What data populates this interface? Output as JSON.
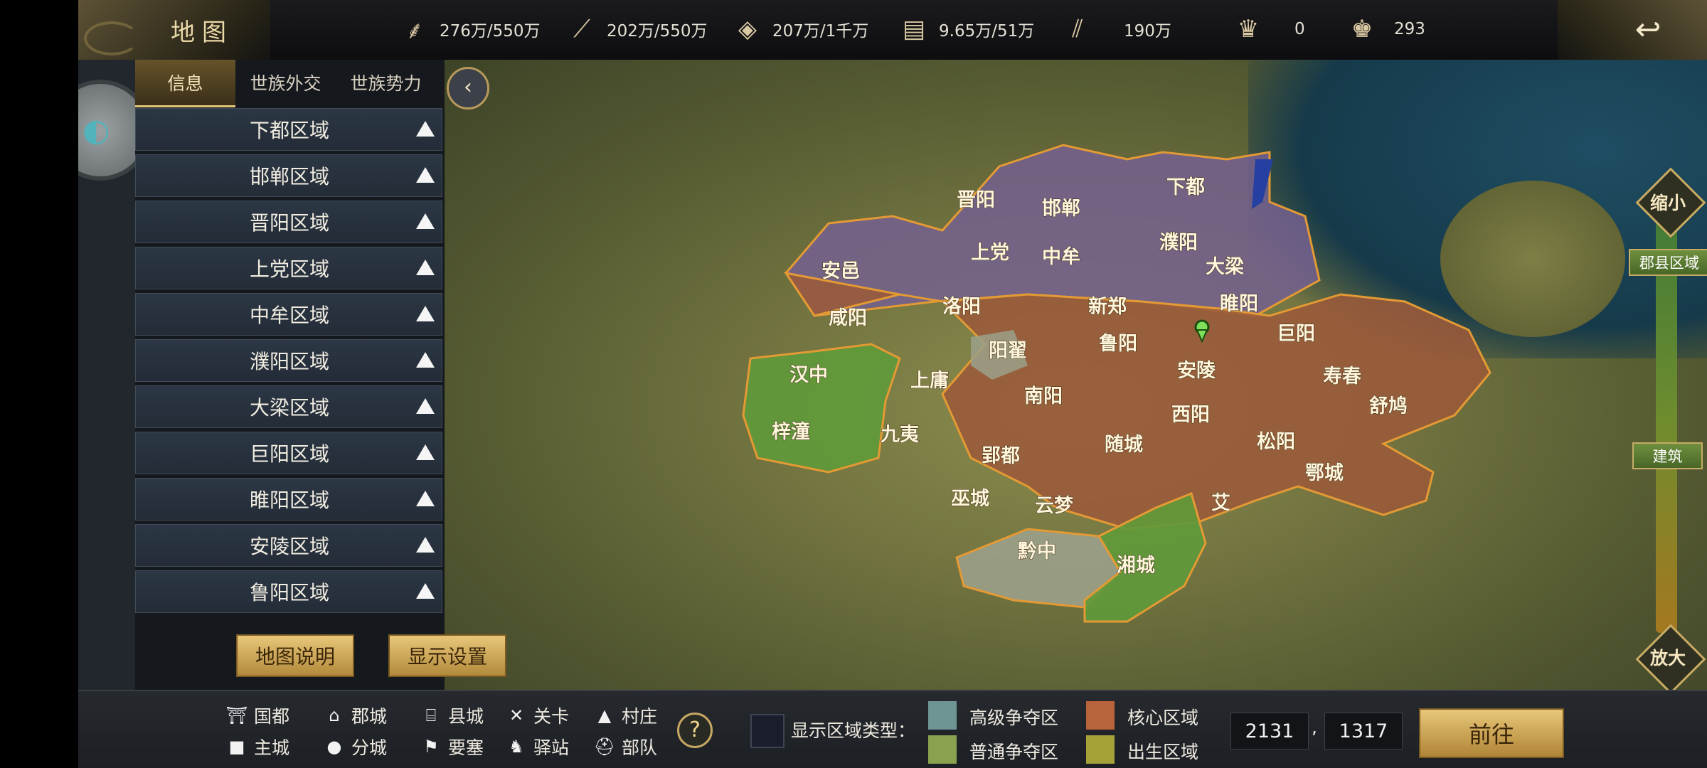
{
  "header": {
    "title": "地图",
    "resources": [
      {
        "icon": "grain-icon",
        "value": "276万/550万"
      },
      {
        "icon": "wood-icon",
        "value": "202万/550万"
      },
      {
        "icon": "stone-icon",
        "value": "207万/1千万"
      },
      {
        "icon": "iron-icon",
        "value": "9.65万/51万"
      },
      {
        "icon": "copper-icon",
        "value": "190万"
      },
      {
        "icon": "gold-ingot-icon",
        "value": "0"
      },
      {
        "icon": "silver-ingot-icon",
        "value": "293"
      }
    ]
  },
  "panel": {
    "tabs": [
      "信息",
      "世族外交",
      "世族势力"
    ],
    "regions": [
      "下都区域",
      "邯郸区域",
      "晋阳区域",
      "上党区域",
      "中牟区域",
      "濮阳区域",
      "大梁区域",
      "巨阳区域",
      "睢阳区域",
      "安陵区域",
      "鲁阳区域"
    ],
    "map_help_label": "地图说明",
    "display_settings_label": "显示设置"
  },
  "map": {
    "cities": [
      "晋阳",
      "邯郸",
      "下都",
      "上党",
      "中牟",
      "濮阳",
      "大梁",
      "安邑",
      "洛阳",
      "新郑",
      "睢阳",
      "咸阳",
      "阳翟",
      "鲁阳",
      "巨阳",
      "汉中",
      "上庸",
      "安陵",
      "寿春",
      "南阳",
      "舒鸠",
      "梓潼",
      "九夷",
      "西阳",
      "随城",
      "松阳",
      "郢都",
      "鄂城",
      "巫城",
      "云梦",
      "艾",
      "黔中",
      "湘城"
    ],
    "colors": {
      "purple": "#74608f",
      "core": "#9b5a3a",
      "green": "#5f9a3a",
      "gray": "#9ba08a"
    }
  },
  "zoom": {
    "zoom_in": "缩小",
    "zoom_out": "放大",
    "tag_region": "郡县区域",
    "tag_build": "建筑"
  },
  "legend": {
    "capital": "国都",
    "prefecture": "郡城",
    "county": "县城",
    "pass": "关卡",
    "village": "村庄",
    "main_city": "主城",
    "branch_city": "分城",
    "fortress": "要塞",
    "post_station": "驿站",
    "troops": "部队",
    "show_region_type": "显示区域类型：",
    "high_contest": "高级争夺区",
    "normal_contest": "普通争夺区",
    "core_region": "核心区域",
    "birth_region": "出生区域",
    "swatch_colors": {
      "high": "#6e9493",
      "normal": "#8aa150",
      "core": "#b8633a",
      "birth": "#a5a23a"
    }
  },
  "coords": {
    "x": "2131",
    "separator": ",",
    "y": "1317",
    "go_label": "前往"
  }
}
